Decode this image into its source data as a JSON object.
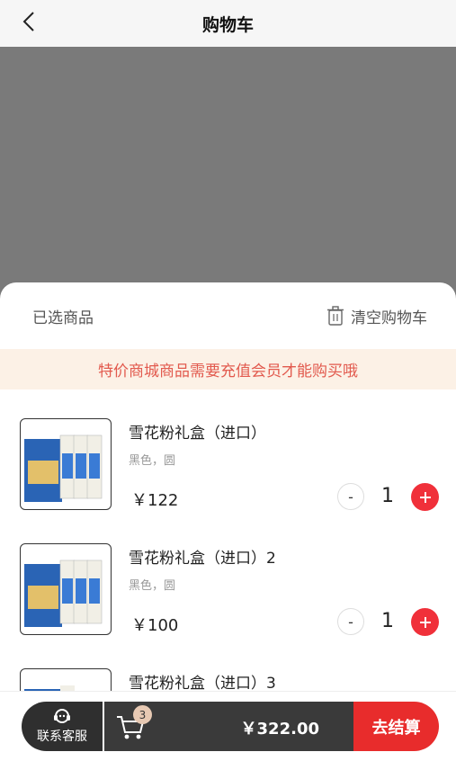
{
  "header": {
    "title": "购物车"
  },
  "sheet": {
    "selected_label": "已选商品",
    "clear_label": "清空购物车",
    "notice": "特价商城商品需要充值会员才能购买哦"
  },
  "items": [
    {
      "name": "雪花粉礼盒（进口）",
      "spec": "黑色，圆",
      "price": "￥122",
      "minus": "-",
      "qty": "1"
    },
    {
      "name": "雪花粉礼盒（进口）2",
      "spec": "黑色，圆",
      "price": "￥100",
      "minus": "-",
      "qty": "1"
    },
    {
      "name": "雪花粉礼盒（进口）3",
      "spec": "",
      "price": "",
      "minus": "-",
      "qty": ""
    }
  ],
  "bottom_bar": {
    "service_label": "联系客服",
    "cart_count": "3",
    "total": "￥322.00",
    "checkout_label": "去结算"
  },
  "colors": {
    "accent_red": "#e82c2c",
    "plus_red": "#f0303a",
    "notice_bg": "#fcf1e6",
    "notice_text": "#e25a4e"
  }
}
